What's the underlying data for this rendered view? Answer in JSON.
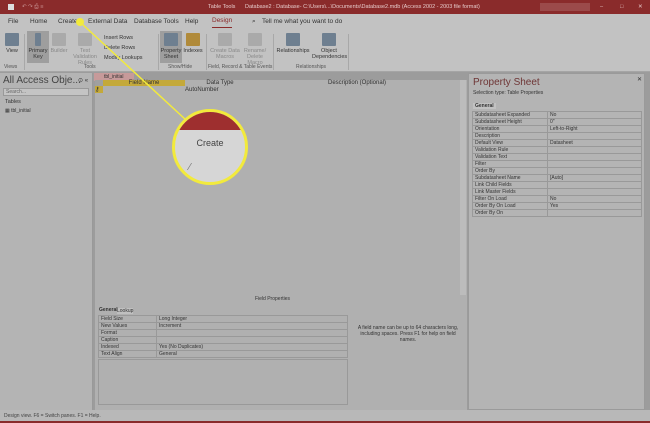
{
  "titlebar": {
    "context": "Table Tools",
    "title": "Database2 : Database- C:\\Users\\...\\Documents\\Database2.mdb (Access 2002 - 2003 file format) - Access"
  },
  "menu": {
    "items": [
      "File",
      "Home",
      "Create",
      "External Data",
      "Database Tools",
      "Help",
      "Design"
    ],
    "tell_me": "Tell me what you want to do"
  },
  "ribbon": {
    "buttons": [
      {
        "label": "View"
      },
      {
        "label": "Primary Key"
      },
      {
        "label": "Builder"
      },
      {
        "label": "Test Validation Rules"
      },
      {
        "label": "Property Sheet"
      },
      {
        "label": "Indexes"
      },
      {
        "label": "Create Data Macros"
      },
      {
        "label": "Rename/ Delete Macro"
      },
      {
        "label": "Relationships"
      },
      {
        "label": "Object Dependencies"
      }
    ],
    "small": [
      "Insert Rows",
      "Delete Rows",
      "Modify Lookups"
    ],
    "groups": [
      "Views",
      "Tools",
      "Show/Hide",
      "Field, Record & Table Events",
      "Relationships"
    ]
  },
  "nav": {
    "title": "All Access Obje...",
    "search_placeholder": "Search...",
    "section": "Tables",
    "items": [
      "tbl_initial"
    ]
  },
  "doc_tab": "tbl_initial",
  "grid": {
    "headers": [
      "Field Name",
      "Data Type",
      "Description (Optional)"
    ],
    "rows": [
      [
        "",
        "AutoNumber",
        ""
      ]
    ]
  },
  "field_properties": {
    "title": "Field Properties",
    "tabs": [
      "General",
      "Lookup"
    ],
    "rows": [
      [
        "Field Size",
        "Long Integer"
      ],
      [
        "New Values",
        "Increment"
      ],
      [
        "Format",
        ""
      ],
      [
        "Caption",
        ""
      ],
      [
        "Indexed",
        "Yes (No Duplicates)"
      ],
      [
        "Text Align",
        "General"
      ]
    ],
    "help": "A field name can be up to 64 characters long, including spaces. Press F1 for help on field names."
  },
  "property_sheet": {
    "title": "Property Sheet",
    "selection_type": "Selection type:  Table Properties",
    "tab": "General",
    "rows": [
      [
        "Subdatasheet Expanded",
        "No"
      ],
      [
        "Subdatasheet Height",
        "0\""
      ],
      [
        "Orientation",
        "Left-to-Right"
      ],
      [
        "Description",
        ""
      ],
      [
        "Default View",
        "Datasheet"
      ],
      [
        "Validation Rule",
        ""
      ],
      [
        "Validation Text",
        ""
      ],
      [
        "Filter",
        ""
      ],
      [
        "Order By",
        ""
      ],
      [
        "Subdatasheet Name",
        "[Auto]"
      ],
      [
        "Link Child Fields",
        ""
      ],
      [
        "Link Master Fields",
        ""
      ],
      [
        "Filter On Load",
        "No"
      ],
      [
        "Order By On Load",
        "Yes"
      ],
      [
        "Order By On",
        ""
      ]
    ]
  },
  "status": "Design view.  F6 = Switch panes.  F1 = Help.",
  "magnifier": {
    "label": "Create"
  },
  "colors": {
    "accent": "#8a2b2b",
    "highlight": "#f2ea3c"
  }
}
